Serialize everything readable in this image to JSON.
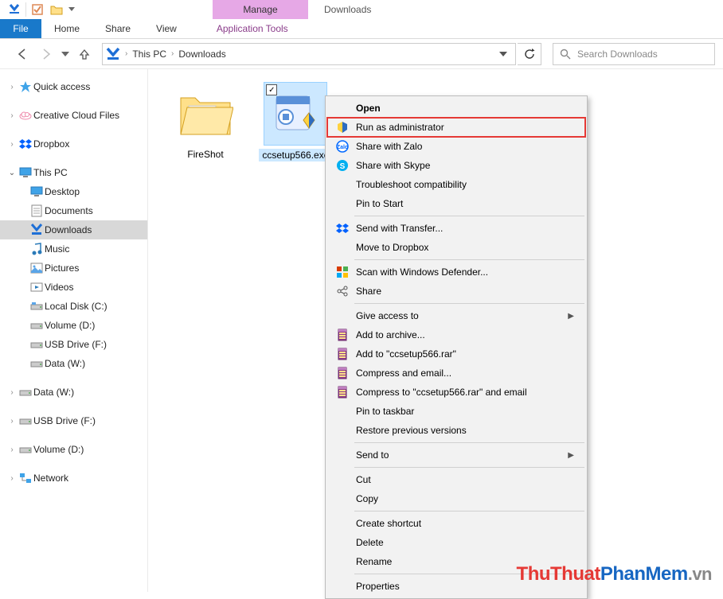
{
  "window_title": "Downloads",
  "ribbon_context_group": "Manage",
  "ribbon_context_tab": "Application Tools",
  "ribbon": {
    "file": "File",
    "tabs": [
      "Home",
      "Share",
      "View"
    ]
  },
  "breadcrumbs": [
    "This PC",
    "Downloads"
  ],
  "search_placeholder": "Search Downloads",
  "tree": {
    "quick_access": "Quick access",
    "ccf": "Creative Cloud Files",
    "dropbox": "Dropbox",
    "this_pc": "This PC",
    "children": [
      "Desktop",
      "Documents",
      "Downloads",
      "Music",
      "Pictures",
      "Videos",
      "Local Disk (C:)",
      "Volume (D:)",
      "USB Drive (F:)",
      "Data (W:)"
    ],
    "selected_child_index": 2,
    "data_w": "Data (W:)",
    "usb_f": "USB Drive (F:)",
    "vol_d": "Volume (D:)",
    "network": "Network"
  },
  "files": {
    "folder1": "FireShot",
    "exe1": "ccsetup566.exe"
  },
  "context_menu": [
    {
      "label": "Open",
      "bold": true
    },
    {
      "label": "Run as administrator",
      "icon": "shield",
      "highlight": true
    },
    {
      "label": "Share with Zalo",
      "icon": "zalo"
    },
    {
      "label": "Share with Skype",
      "icon": "skype"
    },
    {
      "label": "Troubleshoot compatibility"
    },
    {
      "label": "Pin to Start"
    },
    {
      "sep": true
    },
    {
      "label": "Send with Transfer...",
      "icon": "dropbox"
    },
    {
      "label": "Move to Dropbox"
    },
    {
      "sep": true
    },
    {
      "label": "Scan with Windows Defender...",
      "icon": "defender"
    },
    {
      "label": "Share",
      "icon": "share"
    },
    {
      "sep": true
    },
    {
      "label": "Give access to",
      "submenu": true
    },
    {
      "label": "Add to archive...",
      "icon": "rar"
    },
    {
      "label": "Add to \"ccsetup566.rar\"",
      "icon": "rar"
    },
    {
      "label": "Compress and email...",
      "icon": "rar"
    },
    {
      "label": "Compress to \"ccsetup566.rar\" and email",
      "icon": "rar"
    },
    {
      "label": "Pin to taskbar"
    },
    {
      "label": "Restore previous versions"
    },
    {
      "sep": true
    },
    {
      "label": "Send to",
      "submenu": true
    },
    {
      "sep": true
    },
    {
      "label": "Cut"
    },
    {
      "label": "Copy"
    },
    {
      "sep": true
    },
    {
      "label": "Create shortcut"
    },
    {
      "label": "Delete"
    },
    {
      "label": "Rename"
    },
    {
      "sep": true
    },
    {
      "label": "Properties"
    }
  ],
  "watermark": {
    "part1": "ThuThuat",
    "part2": "PhanMem",
    "part3": ".vn"
  }
}
